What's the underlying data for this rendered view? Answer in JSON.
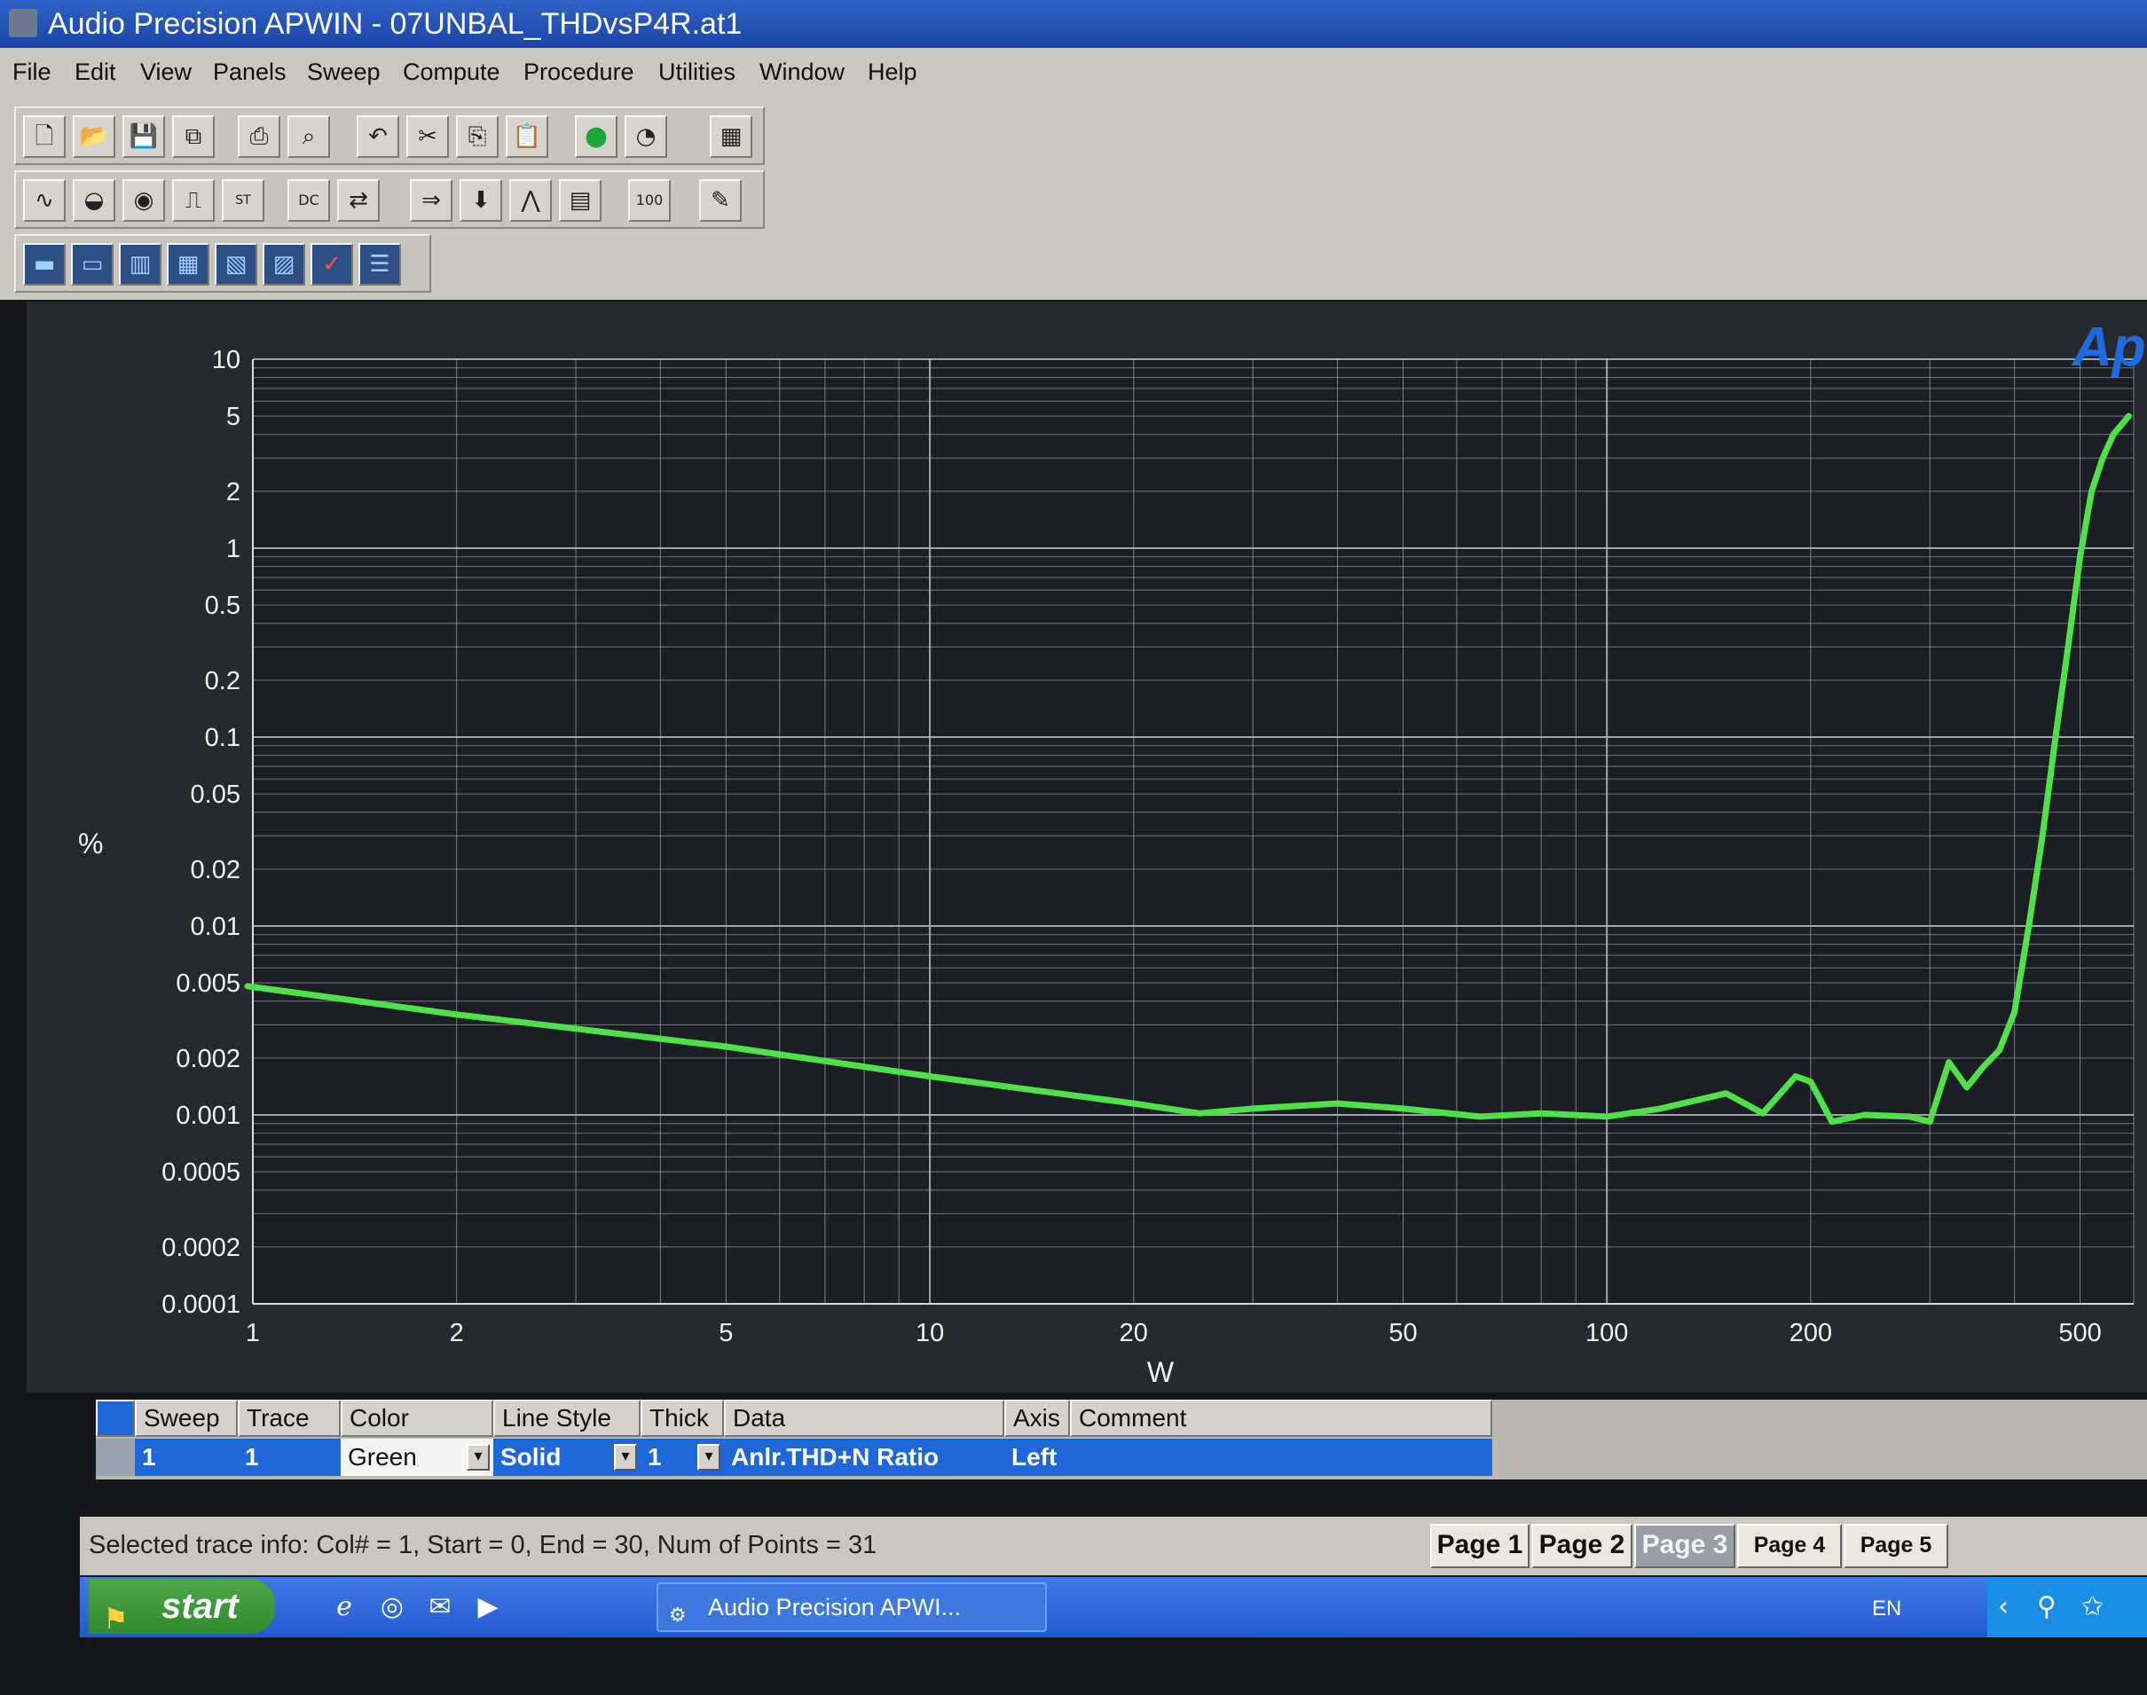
{
  "window": {
    "title": "Audio Precision APWIN - 07UNBAL_THDvsP4R.at1"
  },
  "menu": [
    "File",
    "Edit",
    "View",
    "Panels",
    "Sweep",
    "Compute",
    "Procedure",
    "Utilities",
    "Window",
    "Help"
  ],
  "toolbar_icons": {
    "row1": [
      "new-file-icon",
      "open-folder-icon",
      "save-icon",
      "save-all-icon",
      "print-icon",
      "print-preview-icon",
      "undo-icon",
      "cut-icon",
      "copy-icon",
      "paste-icon",
      "record-icon",
      "stop-icon",
      "graph-icon"
    ],
    "row2": [
      "analog-generator-icon",
      "analog-analyzer-icon",
      "digital-io-icon",
      "waveform-icon",
      "stat-bit-icon",
      "dcx-icon",
      "switcher-icon",
      "run-sweep-icon",
      "down-arrow-icon",
      "fft-icon",
      "table-icon",
      "meter-100-icon",
      "edit-icon"
    ],
    "row3": [
      "panel-1-icon",
      "panel-2-icon",
      "panel-3-icon",
      "panel-4-icon",
      "panel-5-icon",
      "panel-6-icon",
      "check-icon",
      "panel-list-icon"
    ]
  },
  "graph": {
    "logo": "Ap",
    "y_unit": "%",
    "x_unit": "W",
    "background": "#262a2f",
    "grid_color": "#b8bcc4",
    "trace_color": "#4fe04a"
  },
  "chart_data": {
    "type": "line",
    "x_scale": "log",
    "y_scale": "log",
    "xlabel": "W",
    "ylabel": "%",
    "xlim": [
      1,
      600
    ],
    "ylim": [
      0.0001,
      10
    ],
    "x_ticks": [
      1,
      2,
      5,
      10,
      20,
      50,
      100,
      200,
      500
    ],
    "x_tick_labels": [
      "1",
      "2",
      "5",
      "10",
      "20",
      "50",
      "100",
      "200",
      "500"
    ],
    "y_ticks": [
      10,
      5,
      2,
      1,
      0.5,
      0.2,
      0.1,
      0.05,
      0.02,
      0.01,
      0.005,
      0.002,
      0.001,
      0.0005,
      0.0002,
      0.0001
    ],
    "y_tick_labels": [
      "10",
      "5",
      "2",
      "1",
      "0.5",
      "0.2",
      "0.1",
      "0.05",
      "0.02",
      "0.01",
      "0.005",
      "0.002",
      "0.001",
      "0.0005",
      "0.0002",
      "0.0001"
    ],
    "grid": true,
    "series": [
      {
        "color": "#4fe04a",
        "x": [
          0.93,
          2,
          5,
          10,
          20,
          25,
          30,
          40,
          50,
          65,
          80,
          100,
          120,
          150,
          170,
          190,
          200,
          215,
          240,
          280,
          300,
          320,
          340,
          360,
          380,
          400,
          420,
          440,
          460,
          480,
          500,
          520,
          540,
          560,
          590
        ],
        "y": [
          0.0048,
          0.0034,
          0.0023,
          0.0016,
          0.00115,
          0.00102,
          0.00108,
          0.00115,
          0.00108,
          0.00098,
          0.00102,
          0.00098,
          0.00108,
          0.0013,
          0.00102,
          0.0016,
          0.0015,
          0.00092,
          0.001,
          0.00098,
          0.00092,
          0.0019,
          0.0014,
          0.0018,
          0.0022,
          0.0035,
          0.01,
          0.03,
          0.1,
          0.3,
          0.9,
          2.0,
          3.0,
          4.0,
          5.0
        ]
      }
    ]
  },
  "trace_table": {
    "headers": [
      "Sweep",
      "Trace",
      "Color",
      "Line Style",
      "Thick",
      "Data",
      "Axis",
      "Comment"
    ],
    "row": {
      "sweep": "1",
      "trace": "1",
      "color": "Green",
      "line_style": "Solid",
      "thick": "1",
      "data": "Anlr.THD+N Ratio",
      "axis": "Left",
      "comment": ""
    }
  },
  "status": "Selected trace info: Col# = 1, Start = 0, End = 30, Num of Points = 31",
  "pages": [
    {
      "label": "Page 1",
      "active": false
    },
    {
      "label": "Page 2",
      "active": false
    },
    {
      "label": "Page 3",
      "active": true
    },
    {
      "label": "Page 4",
      "active": false
    },
    {
      "label": "Page 5",
      "active": false
    }
  ],
  "taskbar": {
    "start": "start",
    "quick_launch": [
      "ie-icon",
      "media-icon",
      "outlook-icon",
      "player-icon"
    ],
    "task": "Audio Precision APWI...",
    "lang": "EN"
  }
}
